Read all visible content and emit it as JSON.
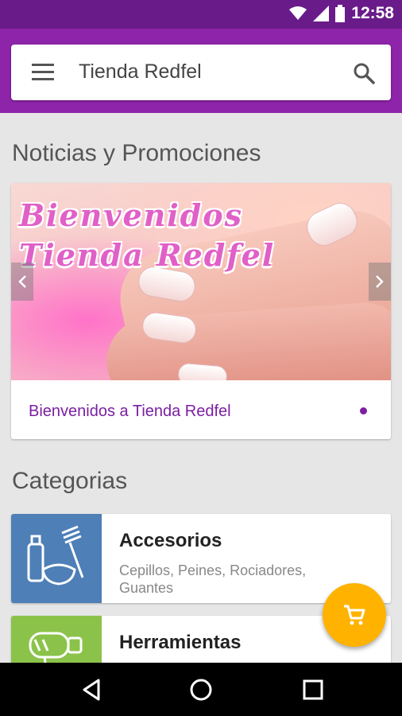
{
  "status_bar": {
    "time": "12:58"
  },
  "search_bar": {
    "title": "Tienda Redfel"
  },
  "news_section": {
    "title": "Noticias y Promociones",
    "banner": {
      "line1": "Bienvenidos",
      "line2": "Tienda Redfel",
      "caption": "Bienvenidos a Tienda Redfel"
    }
  },
  "categories_section": {
    "title": "Categorias",
    "items": [
      {
        "title": "Accesorios",
        "subtitle": "Cepillos, Peines, Rociadores, Guantes",
        "color": "#4e7fb7",
        "icon": "accessories-icon"
      },
      {
        "title": "Herramientas",
        "subtitle": "",
        "color": "#8bc34a",
        "icon": "hair-dryer-icon"
      }
    ]
  },
  "colors": {
    "primary": "#8e24aa",
    "primary_dark": "#6a1b8a",
    "accent": "#ffb300"
  }
}
